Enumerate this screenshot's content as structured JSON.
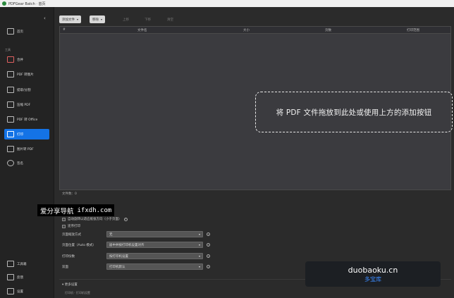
{
  "window": {
    "title": "PDFGear Batch · 首页"
  },
  "sidebar": {
    "home": "首页",
    "section_label": "工具",
    "items": [
      {
        "label": "合并",
        "icon": "merge-icon"
      },
      {
        "label": "PDF 转图片",
        "icon": "pdf-to-image-icon"
      },
      {
        "label": "提取/分割",
        "icon": "split-icon"
      },
      {
        "label": "压缩 PDF",
        "icon": "compress-icon"
      },
      {
        "label": "PDF 转 Office",
        "icon": "convert-icon"
      },
      {
        "label": "打印",
        "icon": "print-icon"
      },
      {
        "label": "图片转 PDF",
        "icon": "image-to-pdf-icon"
      },
      {
        "label": "签名",
        "icon": "sign-icon"
      }
    ],
    "bottom": [
      {
        "label": "工具箱",
        "icon": "toolbox-icon"
      },
      {
        "label": "反馈",
        "icon": "feedback-icon"
      },
      {
        "label": "设置",
        "icon": "settings-icon"
      }
    ]
  },
  "toolbar": {
    "add_files": "添加文件",
    "remove": "移除",
    "move_up": "上移",
    "move_down": "下移",
    "clear": "清空"
  },
  "table": {
    "columns": [
      "#",
      "文件名",
      "大小",
      "页数",
      "打印范围"
    ]
  },
  "dropzone": {
    "text": "将 PDF 文件拖放到此处或使用上方的添加按钮"
  },
  "status": {
    "file_count": "文件数：0"
  },
  "settings": {
    "checkbox1": "自动旋转以适应纸张方向（小于页面）",
    "checkbox2": "逆序打印",
    "options": [
      {
        "label": "页面缩放方式",
        "value": "无"
      },
      {
        "label": "页面位置（Auto 模式）",
        "value": "居中并按打印机设置对齐"
      },
      {
        "label": "打印份数",
        "value": "按打印机设置"
      },
      {
        "label": "双面",
        "value": "打印机默认"
      }
    ]
  },
  "more_settings": {
    "header": "▾ 更多设置",
    "sub": "打印机 · 打印机设置"
  },
  "watermark1": {
    "text": "爱分享导航",
    "url": "ifxdh.com"
  },
  "watermark2": {
    "big": "duobaoku.cn",
    "small": "多宝库"
  },
  "colors": {
    "accent": "#1473e6",
    "sidebar_bg": "#232323",
    "table_bg": "#3b3b3f"
  }
}
